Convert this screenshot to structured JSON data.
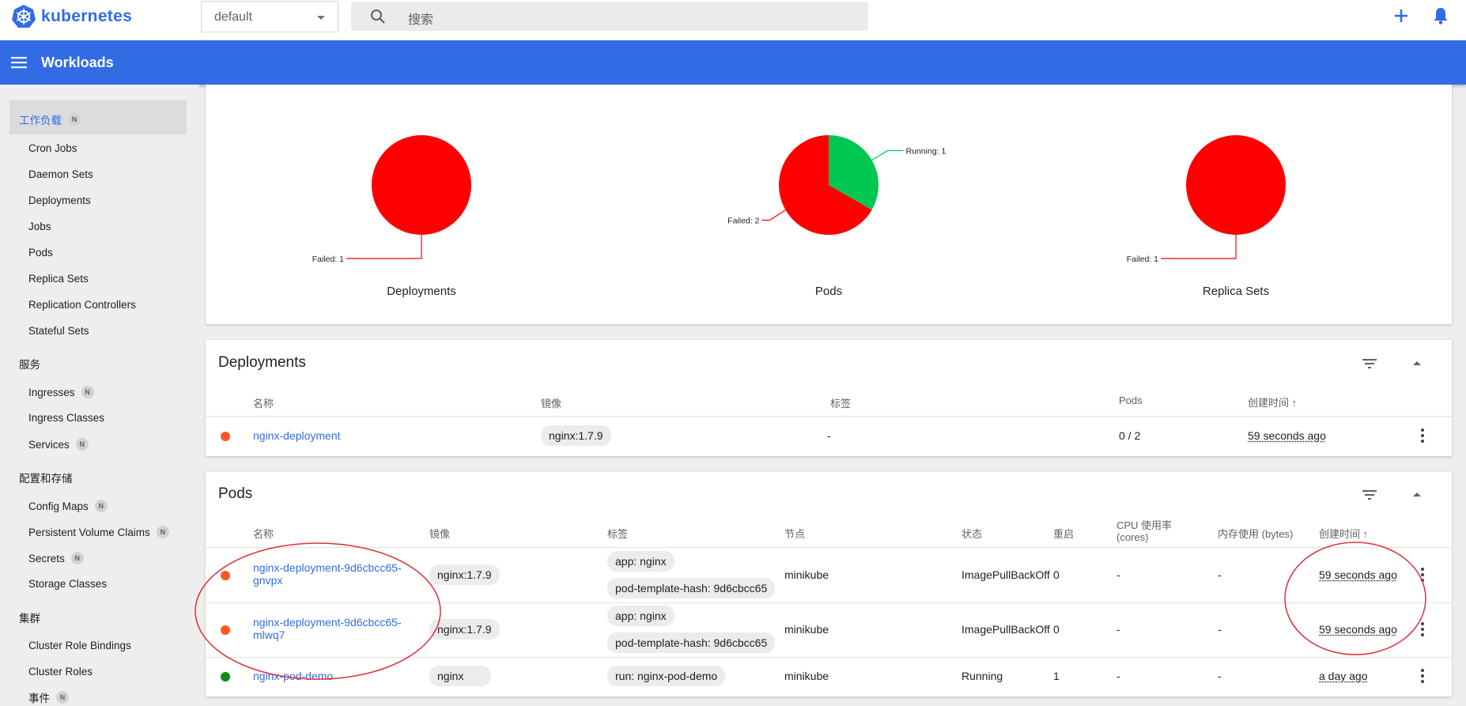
{
  "app": {
    "brand": "kubernetes",
    "namespace": "default",
    "search_placeholder": "搜索"
  },
  "header": {
    "title": "Workloads"
  },
  "sidebar": {
    "workloads_category": "工作负载",
    "workloads_badge": "N",
    "workloads_items": [
      "Cron Jobs",
      "Daemon Sets",
      "Deployments",
      "Jobs",
      "Pods",
      "Replica Sets",
      "Replication Controllers",
      "Stateful Sets"
    ],
    "services_category": "服务",
    "services_items": [
      {
        "label": "Ingresses",
        "badge": "N"
      },
      {
        "label": "Ingress Classes",
        "badge": ""
      },
      {
        "label": "Services",
        "badge": "N"
      }
    ],
    "config_category": "配置和存储",
    "config_items": [
      {
        "label": "Config Maps",
        "badge": "N"
      },
      {
        "label": "Persistent Volume Claims",
        "badge": "N"
      },
      {
        "label": "Secrets",
        "badge": "N"
      },
      {
        "label": "Storage Classes",
        "badge": ""
      }
    ],
    "cluster_category": "集群",
    "cluster_items": [
      {
        "label": "Cluster Role Bindings",
        "badge": ""
      },
      {
        "label": "Cluster Roles",
        "badge": ""
      },
      {
        "label": "事件",
        "badge": "N"
      }
    ]
  },
  "colors": {
    "failed": "#ff0000",
    "running": "#00c752",
    "accent": "#326ce5",
    "status_error": "#ff5722",
    "status_ok": "#108a18"
  },
  "chart_data": [
    {
      "type": "pie",
      "title": "Deployments",
      "slices": [
        {
          "label": "Failed",
          "value": 1,
          "color": "#ff0000"
        }
      ],
      "labels": [
        "Failed: 1"
      ]
    },
    {
      "type": "pie",
      "title": "Pods",
      "slices": [
        {
          "label": "Running",
          "value": 1,
          "color": "#00c752"
        },
        {
          "label": "Failed",
          "value": 2,
          "color": "#ff0000"
        }
      ],
      "labels": [
        "Running: 1",
        "Failed: 2"
      ]
    },
    {
      "type": "pie",
      "title": "Replica Sets",
      "slices": [
        {
          "label": "Failed",
          "value": 1,
          "color": "#ff0000"
        }
      ],
      "labels": [
        "Failed: 1"
      ]
    }
  ],
  "deployments": {
    "title": "Deployments",
    "columns": [
      "名称",
      "镜像",
      "标签",
      "Pods",
      "创建时间"
    ],
    "sort_arrow": "↑",
    "rows": [
      {
        "name": "nginx-deployment",
        "image": "nginx:1.7.9",
        "labels": "-",
        "pods": "0 / 2",
        "created": "59 seconds ago",
        "status": "error"
      }
    ]
  },
  "pods": {
    "title": "Pods",
    "columns": [
      "名称",
      "镜像",
      "标签",
      "节点",
      "状态",
      "重启",
      "CPU 使用率",
      "(cores)",
      "内存使用 (bytes)",
      "创建时间"
    ],
    "sort_arrow": "↑",
    "rows": [
      {
        "name_line1": "nginx-deployment-9d6cbcc65-",
        "name_line2": "gnvpx",
        "image": "nginx:1.7.9",
        "label1": "app: nginx",
        "label2": "pod-template-hash: 9d6cbcc65",
        "node": "minikube",
        "status": "ImagePullBackOff",
        "restarts": "0",
        "cpu": "-",
        "mem": "-",
        "created": "59 seconds ago"
      },
      {
        "name_line1": "nginx-deployment-9d6cbcc65-",
        "name_line2": "mlwq7",
        "image": "nginx:1.7.9",
        "label1": "app: nginx",
        "label2": "pod-template-hash: 9d6cbcc65",
        "node": "minikube",
        "status": "ImagePullBackOff",
        "restarts": "0",
        "cpu": "-",
        "mem": "-",
        "created": "59 seconds ago"
      },
      {
        "name_line1": "nginx-pod-demo",
        "image": "nginx",
        "label1": "run: nginx-pod-demo",
        "node": "minikube",
        "status": "Running",
        "restarts": "1",
        "cpu": "-",
        "mem": "-",
        "created": "a day ago"
      }
    ]
  }
}
